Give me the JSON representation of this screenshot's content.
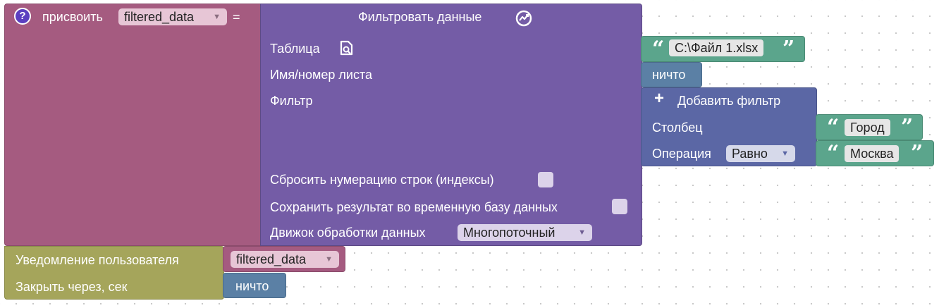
{
  "assign_block": {
    "help_icon": "question-icon",
    "label": "присвоить",
    "variable": "filtered_data",
    "equals": "="
  },
  "filter_block": {
    "title": "Фильтровать данные",
    "title_icon": "chart-refresh-icon",
    "table_label": "Таблица",
    "table_icon": "file-search-icon",
    "sheet_label": "Имя/номер листа",
    "filter_label": "Фильтр",
    "reset_index_label": "Сбросить нумерацию строк (индексы)",
    "save_temp_label": "Сохранить результат во временную базу данных",
    "engine_label": "Движок обработки данных",
    "engine_value": "Многопоточный"
  },
  "table_value": "C:\\Файл 1.xlsx",
  "sheet_value": "ничто",
  "add_filter_block": {
    "plus_icon": "plus-icon",
    "label": "Добавить фильтр",
    "column_label": "Столбец",
    "column_value": "Город",
    "operation_label": "Операция",
    "operation_value": "Равно",
    "operand_value": "Москва"
  },
  "notify_block": {
    "label": "Уведомление пользователя",
    "variable": "filtered_data",
    "close_label": "Закрыть через, сек",
    "close_value": "ничто"
  },
  "colors": {
    "assign": "#a55b80",
    "filter": "#745ca6",
    "text_string": "#5ba58c",
    "null": "#5b80a5",
    "add_filter": "#5b67a5",
    "notify": "#a5a55b"
  }
}
